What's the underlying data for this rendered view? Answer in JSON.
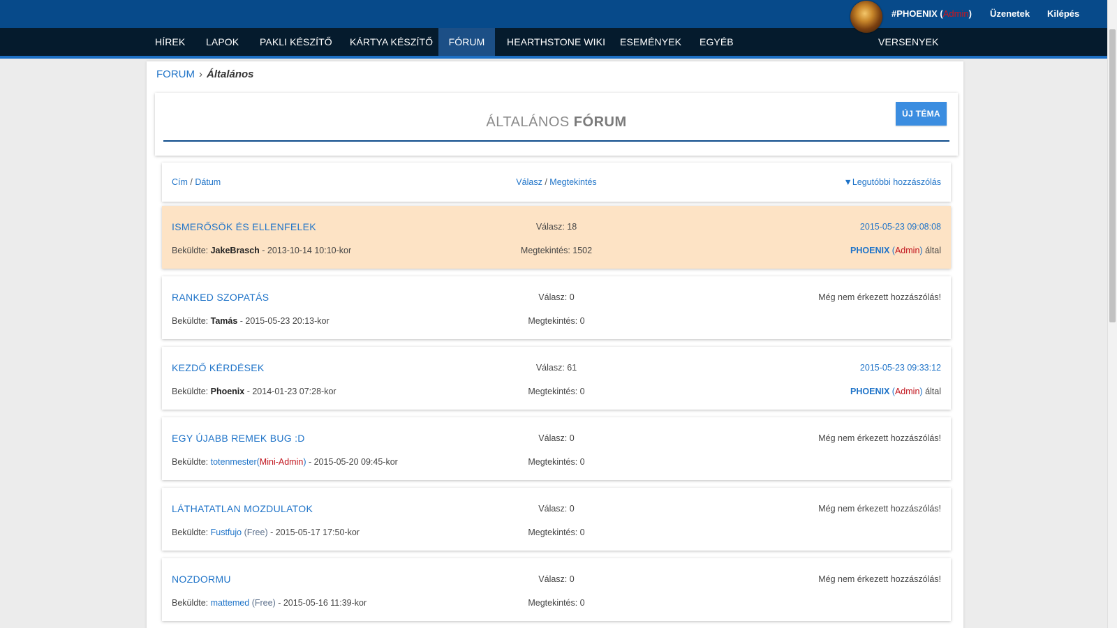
{
  "topbar": {
    "user_name": "#PHOENIX",
    "user_role": "Admin",
    "messages": "Üzenetek",
    "logout": "Kilépés"
  },
  "nav": {
    "items": [
      "HÍREK",
      "LAPOK",
      "PAKLI KÉSZÍTŐ",
      "KÁRTYA KÉSZÍTŐ",
      "FÓRUM",
      "HEARTHSTONE WIKI",
      "ESEMÉNYEK",
      "EGYÉB"
    ],
    "active": "FÓRUM",
    "right_item": "VERSENYEK"
  },
  "breadcrumb": {
    "root": "FORUM",
    "current": "Általános"
  },
  "forum": {
    "title_light": "ÁLTALÁNOS",
    "title_bold": "FÓRUM",
    "new_topic_button": "ÚJ TÉMA"
  },
  "columns": {
    "title": "Cím",
    "date": "Dátum",
    "replies": "Válasz",
    "views": "Megtekintés",
    "sep": "/",
    "last_post": "▼Legutóbbi hozzászólás"
  },
  "labels": {
    "submitted_by": "Beküldte:",
    "replies_prefix": "Válasz:",
    "views_prefix": "Megtekintés:",
    "by_suffix": "által",
    "no_posts": "Még nem érkezett hozzászólás!"
  },
  "topics": [
    {
      "title": "ISMERŐSÖK ÉS ELLENFELEK",
      "author": "JakeBrasch",
      "author_role": "",
      "date": "- 2013-10-14 10:10-kor",
      "replies": "Válasz: 18",
      "views": "Megtekintés: 1502",
      "last_date": "2015-05-23 09:08:08",
      "last_by": "PHOENIX",
      "last_role": "Admin",
      "highlighted": true
    },
    {
      "title": "RANKED SZOPATÁS",
      "author": "Tamás",
      "author_role": "",
      "date": "- 2015-05-23 20:13-kor",
      "replies": "Válasz: 0",
      "views": "Megtekintés: 0",
      "last_date": "Még nem érkezett hozzászólás!",
      "last_by": "",
      "last_role": ""
    },
    {
      "title": "KEZDŐ KÉRDÉSEK",
      "author": "Phoenix",
      "author_role": "",
      "date": "- 2014-01-23 07:28-kor",
      "replies": "Válasz: 61",
      "views": "Megtekintés: 0",
      "last_date": "2015-05-23 09:33:12",
      "last_by": "PHOENIX",
      "last_role": "Admin"
    },
    {
      "title": "EGY ÚJABB REMEK BUG :D",
      "author": "totenmester",
      "author_role": "Mini-Admin",
      "date": "- 2015-05-20 09:45-kor",
      "replies": "Válasz: 0",
      "views": "Megtekintés: 0",
      "last_date": "Még nem érkezett hozzászólás!",
      "last_by": "",
      "last_role": ""
    },
    {
      "title": "LÁTHATATLAN MOZDULATOK",
      "author": "Fustfujo",
      "author_role": "Free",
      "date": "- 2015-05-17 17:50-kor",
      "replies": "Válasz: 0",
      "views": "Megtekintés: 0",
      "last_date": "Még nem érkezett hozzászólás!",
      "last_by": "",
      "last_role": ""
    },
    {
      "title": "NOZDORMU",
      "author": "mattemed",
      "author_role": "Free",
      "date": "- 2015-05-16 11:39-kor",
      "replies": "Válasz: 0",
      "views": "Megtekintés: 0",
      "last_date": "Még nem érkezett hozzászólás!",
      "last_by": "",
      "last_role": ""
    }
  ]
}
